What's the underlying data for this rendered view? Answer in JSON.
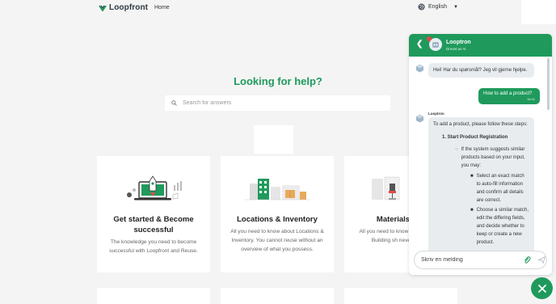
{
  "brand": {
    "name": "Loopfront"
  },
  "nav": {
    "home": "Home"
  },
  "language": {
    "label": "English",
    "icon": "globe-icon"
  },
  "hero": {
    "title": "Looking for help?",
    "search_placeholder": "Search for answers"
  },
  "cards": [
    {
      "title": "Get started & Become successful",
      "description": "The knowledge you need to become successful with Loopfront and Reuse."
    },
    {
      "title": "Locations & Inventory",
      "description": "All you need to know about Locations & Inventory. You cannot reuse without an overview of what you possess."
    },
    {
      "title": "Materials & C",
      "description": "All you need to know ab QR codes. Building sh never been e"
    }
  ],
  "chat": {
    "bot_name": "Looptron",
    "subtitle": "Drevet av AI",
    "greeting": "Hei! Har du spørsmål? Jeg vil gjerne hjelpe.",
    "user_message": "How to add a product?",
    "user_time": "16:41",
    "reply_label": "Looptron",
    "reply_intro": "To add a product, please follow these steps:",
    "step1_title": "1. Start Product Registration",
    "sub_item": "If the system suggests similar products based on your input, you may:",
    "option1": "Select an exact match to auto-fill information and confirm all details are correct.",
    "option2": "Choose a similar match, edit the differing fields, and decide whether to keep or create a new product.",
    "composer_placeholder": "Skriv en melding"
  },
  "colors": {
    "accent": "#1f9a5c",
    "background": "#f4f4f4"
  }
}
